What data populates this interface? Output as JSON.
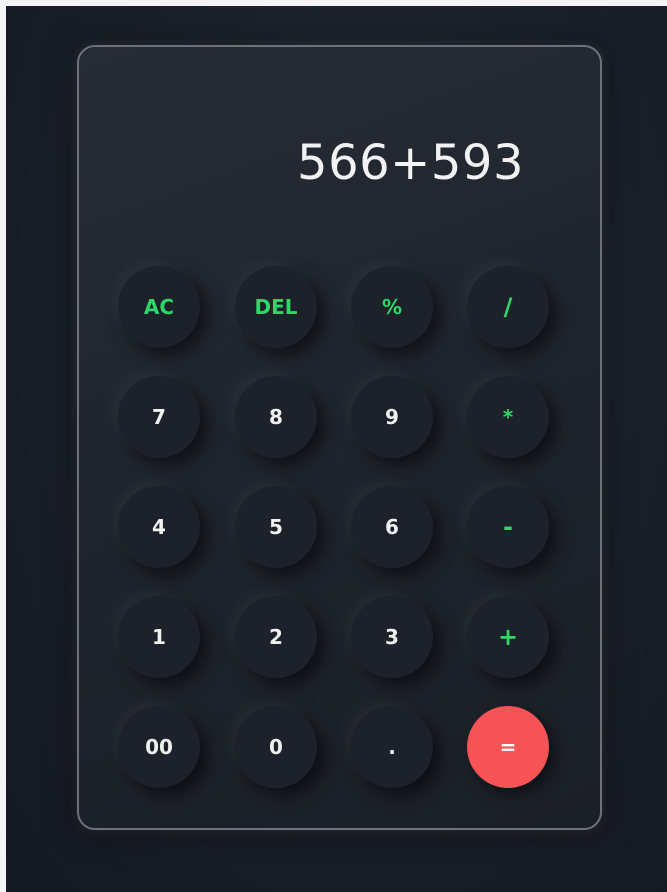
{
  "display": {
    "expression": "566+593"
  },
  "keys": {
    "ac": "AC",
    "del": "DEL",
    "percent": "%",
    "divide": "/",
    "seven": "7",
    "eight": "8",
    "nine": "9",
    "multiply": "*",
    "four": "4",
    "five": "5",
    "six": "6",
    "minus": "-",
    "one": "1",
    "two": "2",
    "three": "3",
    "plus": "+",
    "double_zero": "00",
    "zero": "0",
    "decimal": ".",
    "equals": "="
  },
  "colors": {
    "accent": "#2fd668",
    "equals": "#f55355",
    "panel": "#1f242c",
    "text": "#f2f2f2"
  }
}
